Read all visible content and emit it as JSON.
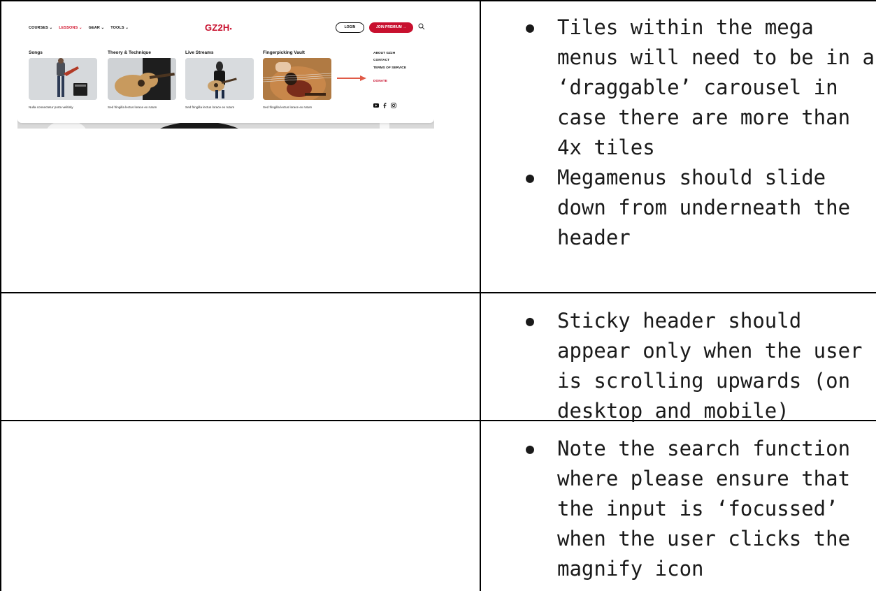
{
  "notes": {
    "row1": [
      "Tiles within the mega menus will need to be in a ‘draggable’ carousel in case there are more than 4x tiles",
      "Megamenus should slide down from underneath the header"
    ],
    "row2": [
      "Sticky header should appear only when the user is scrolling upwards (on desktop and mobile)"
    ],
    "row3": [
      "Note the search function where please ensure that the input is ‘focussed’ when the user clicks the magnify icon"
    ],
    "bullet": "●"
  },
  "site": {
    "logo": "GZ2H",
    "nav": [
      "COURSES",
      "LESSONS",
      "GEAR",
      "TOOLS"
    ],
    "nav_active": "LESSONS",
    "chevron": "⌄",
    "login": "LOGIN",
    "premium": "JOIN PREMIUM →",
    "tiles": [
      {
        "title": "Songs",
        "caption": "Nulla consectetur porta velitinly"
      },
      {
        "title": "Theory & Technique",
        "caption": "Sed fringilla lectus lorace ex rutum"
      },
      {
        "title": "Live Streams",
        "caption": "Sed fringilla lectus lorace ex rutum"
      },
      {
        "title": "Fingerpicking Vault",
        "caption": "Sed fringilla lectus lorace ex rutum"
      }
    ],
    "side_links": [
      "ABOUT GZ2H",
      "CONTACT",
      "TERMS OF SERVICE"
    ],
    "donate": "DONATE",
    "social_icons": [
      "youtube-icon",
      "facebook-icon",
      "instagram-icon"
    ],
    "brand_color": "#c8102e"
  }
}
